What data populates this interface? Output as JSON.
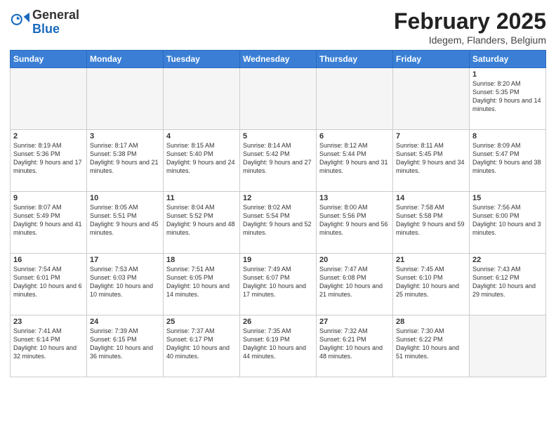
{
  "header": {
    "logo_general": "General",
    "logo_blue": "Blue",
    "month_title": "February 2025",
    "location": "Idegem, Flanders, Belgium"
  },
  "days_of_week": [
    "Sunday",
    "Monday",
    "Tuesday",
    "Wednesday",
    "Thursday",
    "Friday",
    "Saturday"
  ],
  "weeks": [
    [
      {
        "day": "",
        "info": ""
      },
      {
        "day": "",
        "info": ""
      },
      {
        "day": "",
        "info": ""
      },
      {
        "day": "",
        "info": ""
      },
      {
        "day": "",
        "info": ""
      },
      {
        "day": "",
        "info": ""
      },
      {
        "day": "1",
        "info": "Sunrise: 8:20 AM\nSunset: 5:35 PM\nDaylight: 9 hours and 14 minutes."
      }
    ],
    [
      {
        "day": "2",
        "info": "Sunrise: 8:19 AM\nSunset: 5:36 PM\nDaylight: 9 hours and 17 minutes."
      },
      {
        "day": "3",
        "info": "Sunrise: 8:17 AM\nSunset: 5:38 PM\nDaylight: 9 hours and 21 minutes."
      },
      {
        "day": "4",
        "info": "Sunrise: 8:15 AM\nSunset: 5:40 PM\nDaylight: 9 hours and 24 minutes."
      },
      {
        "day": "5",
        "info": "Sunrise: 8:14 AM\nSunset: 5:42 PM\nDaylight: 9 hours and 27 minutes."
      },
      {
        "day": "6",
        "info": "Sunrise: 8:12 AM\nSunset: 5:44 PM\nDaylight: 9 hours and 31 minutes."
      },
      {
        "day": "7",
        "info": "Sunrise: 8:11 AM\nSunset: 5:45 PM\nDaylight: 9 hours and 34 minutes."
      },
      {
        "day": "8",
        "info": "Sunrise: 8:09 AM\nSunset: 5:47 PM\nDaylight: 9 hours and 38 minutes."
      }
    ],
    [
      {
        "day": "9",
        "info": "Sunrise: 8:07 AM\nSunset: 5:49 PM\nDaylight: 9 hours and 41 minutes."
      },
      {
        "day": "10",
        "info": "Sunrise: 8:05 AM\nSunset: 5:51 PM\nDaylight: 9 hours and 45 minutes."
      },
      {
        "day": "11",
        "info": "Sunrise: 8:04 AM\nSunset: 5:52 PM\nDaylight: 9 hours and 48 minutes."
      },
      {
        "day": "12",
        "info": "Sunrise: 8:02 AM\nSunset: 5:54 PM\nDaylight: 9 hours and 52 minutes."
      },
      {
        "day": "13",
        "info": "Sunrise: 8:00 AM\nSunset: 5:56 PM\nDaylight: 9 hours and 56 minutes."
      },
      {
        "day": "14",
        "info": "Sunrise: 7:58 AM\nSunset: 5:58 PM\nDaylight: 9 hours and 59 minutes."
      },
      {
        "day": "15",
        "info": "Sunrise: 7:56 AM\nSunset: 6:00 PM\nDaylight: 10 hours and 3 minutes."
      }
    ],
    [
      {
        "day": "16",
        "info": "Sunrise: 7:54 AM\nSunset: 6:01 PM\nDaylight: 10 hours and 6 minutes."
      },
      {
        "day": "17",
        "info": "Sunrise: 7:53 AM\nSunset: 6:03 PM\nDaylight: 10 hours and 10 minutes."
      },
      {
        "day": "18",
        "info": "Sunrise: 7:51 AM\nSunset: 6:05 PM\nDaylight: 10 hours and 14 minutes."
      },
      {
        "day": "19",
        "info": "Sunrise: 7:49 AM\nSunset: 6:07 PM\nDaylight: 10 hours and 17 minutes."
      },
      {
        "day": "20",
        "info": "Sunrise: 7:47 AM\nSunset: 6:08 PM\nDaylight: 10 hours and 21 minutes."
      },
      {
        "day": "21",
        "info": "Sunrise: 7:45 AM\nSunset: 6:10 PM\nDaylight: 10 hours and 25 minutes."
      },
      {
        "day": "22",
        "info": "Sunrise: 7:43 AM\nSunset: 6:12 PM\nDaylight: 10 hours and 29 minutes."
      }
    ],
    [
      {
        "day": "23",
        "info": "Sunrise: 7:41 AM\nSunset: 6:14 PM\nDaylight: 10 hours and 32 minutes."
      },
      {
        "day": "24",
        "info": "Sunrise: 7:39 AM\nSunset: 6:15 PM\nDaylight: 10 hours and 36 minutes."
      },
      {
        "day": "25",
        "info": "Sunrise: 7:37 AM\nSunset: 6:17 PM\nDaylight: 10 hours and 40 minutes."
      },
      {
        "day": "26",
        "info": "Sunrise: 7:35 AM\nSunset: 6:19 PM\nDaylight: 10 hours and 44 minutes."
      },
      {
        "day": "27",
        "info": "Sunrise: 7:32 AM\nSunset: 6:21 PM\nDaylight: 10 hours and 48 minutes."
      },
      {
        "day": "28",
        "info": "Sunrise: 7:30 AM\nSunset: 6:22 PM\nDaylight: 10 hours and 51 minutes."
      },
      {
        "day": "",
        "info": ""
      }
    ]
  ]
}
